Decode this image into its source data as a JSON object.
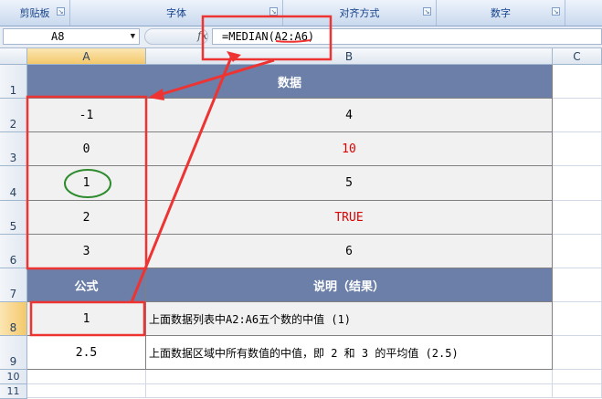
{
  "ribbon": {
    "groups": [
      "剪贴板",
      "字体",
      "对齐方式",
      "数字"
    ]
  },
  "formula_bar": {
    "name_box": "A8",
    "fx": "fx",
    "formula": "=MEDIAN(A2:A6)"
  },
  "columns": [
    "A",
    "B",
    "C"
  ],
  "rows": [
    "1",
    "2",
    "3",
    "4",
    "5",
    "6",
    "7",
    "8",
    "9",
    "10",
    "11"
  ],
  "table": {
    "header": "数据",
    "data": [
      {
        "a": "-1",
        "b": "4"
      },
      {
        "a": "0",
        "b": "10"
      },
      {
        "a": "1",
        "b": "5"
      },
      {
        "a": "2",
        "b": "TRUE"
      },
      {
        "a": "3",
        "b": "6"
      }
    ],
    "formula_header": "公式",
    "desc_header": "说明（结果）",
    "results": [
      {
        "a": "1",
        "b": "上面数据列表中A2:A6五个数的中值 (1)"
      },
      {
        "a": "2.5",
        "b": "上面数据区域中所有数值的中值，即 2 和 3 的平均值 (2.5)"
      }
    ]
  },
  "colors": {
    "header_fill": "#6b7fa8",
    "annotation_red": "#ee3333",
    "annotation_green": "#2e8b2e",
    "text_value_red": "#e00000"
  }
}
